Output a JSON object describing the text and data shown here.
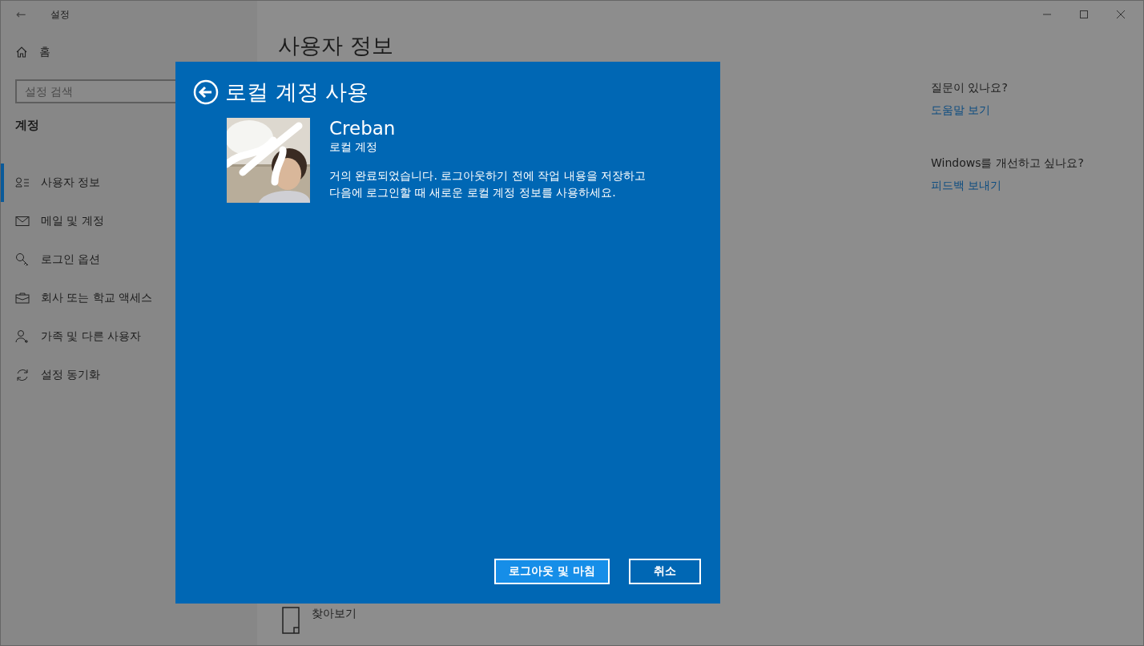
{
  "window": {
    "title": "설정",
    "back": "←"
  },
  "sidebar": {
    "home": "홈",
    "search": {
      "placeholder": "설정 검색"
    },
    "section": "계정",
    "items": [
      {
        "label": "사용자 정보",
        "kind": "user-list",
        "selected": true
      },
      {
        "label": "메일 및 계정",
        "kind": "mail",
        "selected": false
      },
      {
        "label": "로그인 옵션",
        "kind": "key",
        "selected": false
      },
      {
        "label": "회사 또는 학교 액세스",
        "kind": "briefcase",
        "selected": false
      },
      {
        "label": "가족 및 다른 사용자",
        "kind": "user-add",
        "selected": false
      },
      {
        "label": "설정 동기화",
        "kind": "sync",
        "selected": false
      }
    ]
  },
  "main": {
    "heading": "사용자 정보",
    "browse": "찾아보기"
  },
  "help": [
    {
      "question": "질문이 있나요?",
      "link": "도움말 보기"
    },
    {
      "question": "Windows를 개선하고 싶나요?",
      "link": "피드백 보내기"
    }
  ],
  "dialog": {
    "title": "로컬 계정 사용",
    "account_name": "Creban",
    "account_type": "로컬 계정",
    "message": "거의 완료되었습니다. 로그아웃하기 전에 작업 내용을 저장하고\n다음에 로그인할 때 새로운 로컬 계정 정보를 사용하세요.",
    "buttons": [
      {
        "label": "로그아웃 및 마침",
        "kind": "primary"
      },
      {
        "label": "취소",
        "kind": "secondary"
      }
    ]
  }
}
